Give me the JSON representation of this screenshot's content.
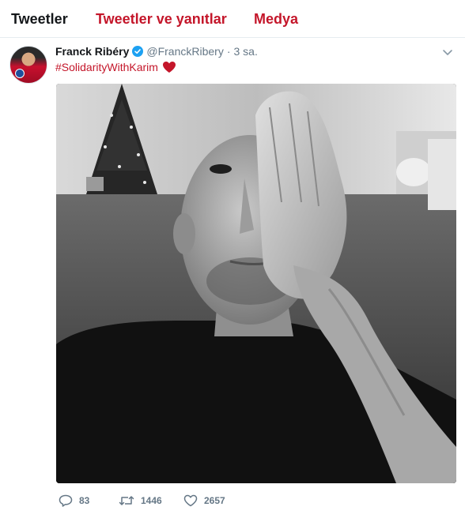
{
  "tabs": {
    "tweets": "Tweetler",
    "tweets_replies": "Tweetler ve yanıtlar",
    "media": "Medya"
  },
  "tweet": {
    "author_name": "Franck Ribéry",
    "handle": "@FranckRibery",
    "separator": "·",
    "time": "3 sa.",
    "hashtag": "#SolidarityWithKarim",
    "emoji": "red-heart-icon",
    "stats": {
      "replies": "83",
      "retweets": "1446",
      "likes": "2657"
    }
  },
  "colors": {
    "accent": "#c4162a",
    "secondary_text": "#657786",
    "verified": "#1da1f2",
    "divider": "#e6ecf0"
  }
}
